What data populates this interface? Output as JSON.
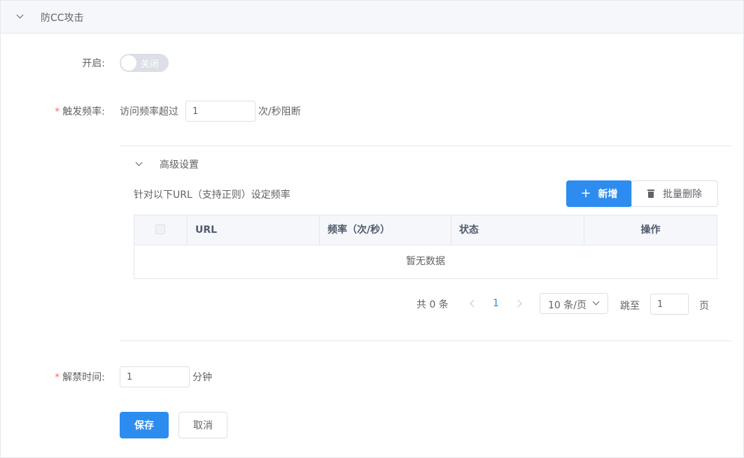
{
  "panel": {
    "title": "防CC攻击"
  },
  "form": {
    "enable": {
      "label": "开启:",
      "switch_text": "关闭",
      "checked": false
    },
    "frequency": {
      "label": "触发频率:",
      "prefix": "访问频率超过",
      "value": "1",
      "suffix": "次/秒阻断"
    },
    "advanced": {
      "title": "高级设置",
      "description": "针对以下URL（支持正则）设定频率",
      "add_button": "新增",
      "batch_delete_button": "批量删除",
      "table": {
        "columns": [
          "URL",
          "频率（次/秒）",
          "状态",
          "操作"
        ],
        "rows": [],
        "empty_text": "暂无数据"
      },
      "pagination": {
        "total_text": "共 0 条",
        "current_page": "1",
        "page_size": "10 条/页",
        "jump_label": "跳至",
        "jump_value": "1",
        "page_suffix": "页"
      }
    },
    "unban": {
      "label": "解禁时间:",
      "value": "1",
      "suffix": "分钟"
    }
  },
  "actions": {
    "save": "保存",
    "cancel": "取消"
  },
  "colors": {
    "primary": "#2d8cf0",
    "required": "#f56c6c",
    "border": "#dcdfe6"
  }
}
